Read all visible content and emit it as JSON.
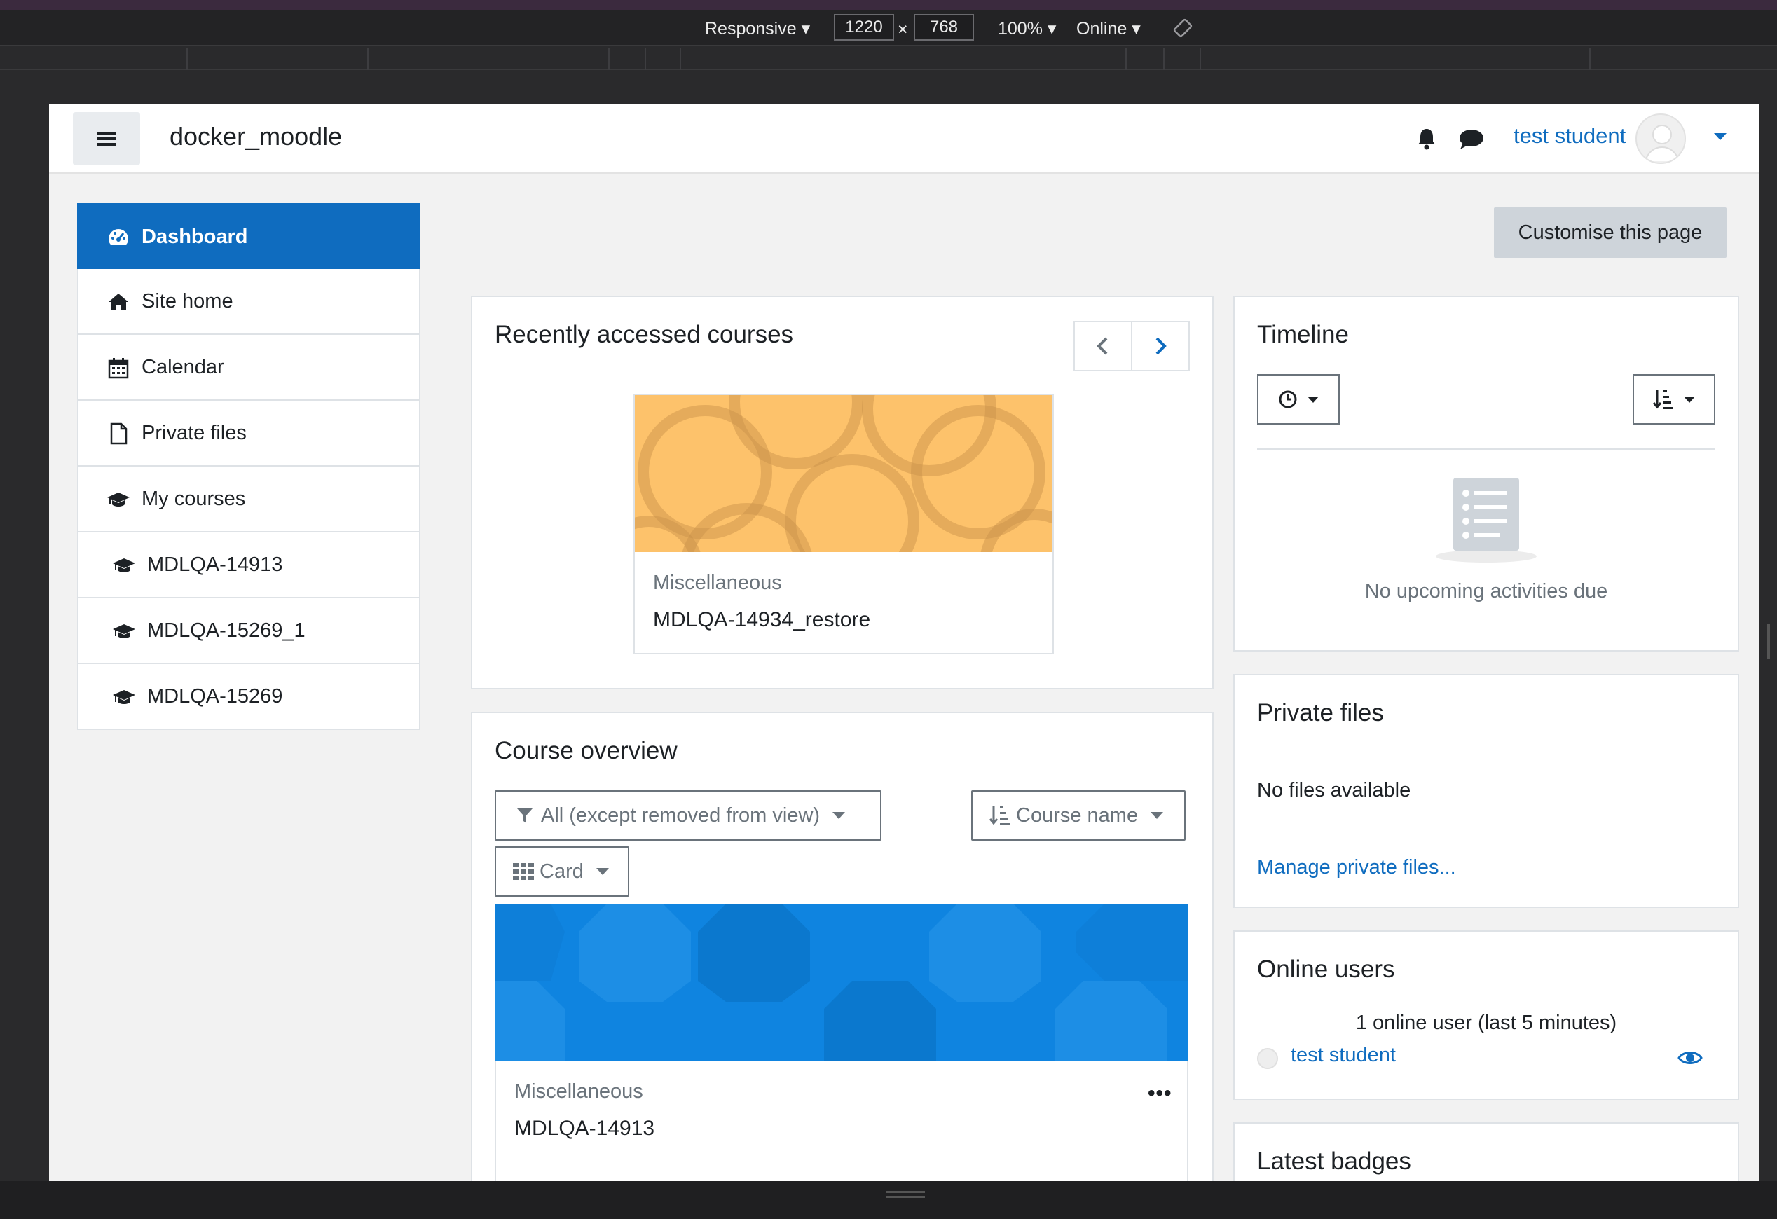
{
  "devtools": {
    "device": "Responsive",
    "width": "1220",
    "times": "×",
    "height": "768",
    "zoom": "100%",
    "network": "Online"
  },
  "navbar": {
    "site_name": "docker_moodle",
    "user_name": "test student"
  },
  "nav": {
    "items": [
      {
        "label": "Dashboard",
        "icon": "dashboard-icon",
        "active": true
      },
      {
        "label": "Site home",
        "icon": "home-icon"
      },
      {
        "label": "Calendar",
        "icon": "calendar-icon"
      },
      {
        "label": "Private files",
        "icon": "file-icon"
      },
      {
        "label": "My courses",
        "icon": "graduation-cap-icon"
      },
      {
        "label": "MDLQA-14913",
        "icon": "graduation-cap-icon"
      },
      {
        "label": "MDLQA-15269_1",
        "icon": "graduation-cap-icon"
      },
      {
        "label": "MDLQA-15269",
        "icon": "graduation-cap-icon"
      }
    ]
  },
  "main": {
    "customise_label": "Customise this page",
    "recent": {
      "title": "Recently accessed courses",
      "course": {
        "category": "Miscellaneous",
        "name": "MDLQA-14934_restore"
      }
    },
    "overview": {
      "title": "Course overview",
      "filter_label": "All (except removed from view)",
      "sort_label": "Course name",
      "view_label": "Card",
      "course": {
        "category": "Miscellaneous",
        "name": "MDLQA-14913",
        "menu": "•••"
      }
    }
  },
  "blocks": {
    "timeline": {
      "title": "Timeline",
      "empty": "No upcoming activities due"
    },
    "private_files": {
      "title": "Private files",
      "empty": "No files available",
      "manage_link": "Manage private files..."
    },
    "online_users": {
      "title": "Online users",
      "count": "1 online user (last 5 minutes)",
      "user": "test student"
    },
    "latest_badges": {
      "title": "Latest badges"
    }
  },
  "colors": {
    "primary": "#0f6cbf",
    "recent_course_image": "#fdc26b",
    "overview_course_image": "#0f84e0"
  }
}
